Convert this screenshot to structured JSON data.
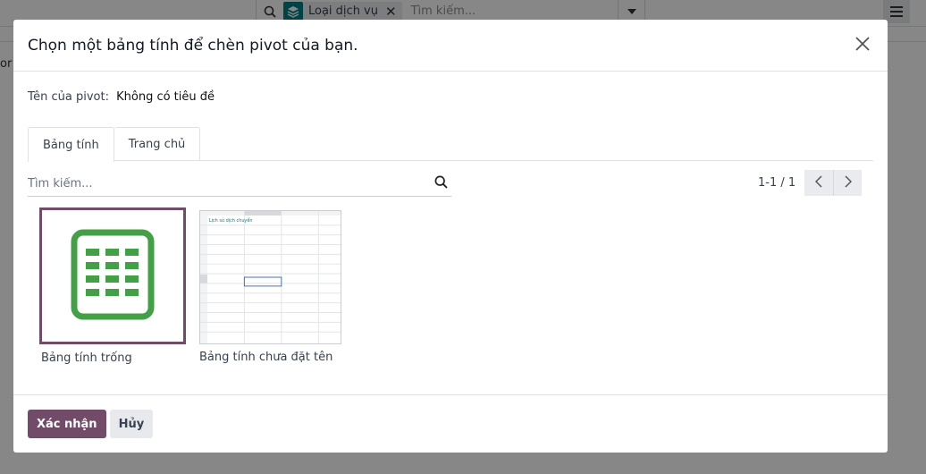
{
  "background": {
    "search_facet_label": "Loại dịch vụ",
    "search_placeholder": "Tìm kiếm...",
    "side_text": "or"
  },
  "dialog": {
    "title": "Chọn một bảng tính để chèn pivot của bạn.",
    "pivot_name_label": "Tên của pivot:",
    "pivot_name_value": "Không có tiêu đề",
    "tabs": [
      {
        "label": "Bảng tính",
        "active": true
      },
      {
        "label": "Trang chủ",
        "active": false
      }
    ],
    "search_placeholder": "Tìm kiếm...",
    "pager": "1-1 / 1",
    "items": [
      {
        "label": "Bảng tính trống",
        "selected": true,
        "icon": "spreadsheet-icon"
      },
      {
        "label": "Bảng tính chưa đặt tên",
        "selected": false,
        "thumbnail_title": "Lịch sử dịch chuyển"
      }
    ],
    "confirm_label": "Xác nhận",
    "cancel_label": "Hủy"
  },
  "colors": {
    "primary": "#714b67",
    "spreadsheet_green": "#43a047",
    "facet_icon": "#017e84"
  }
}
